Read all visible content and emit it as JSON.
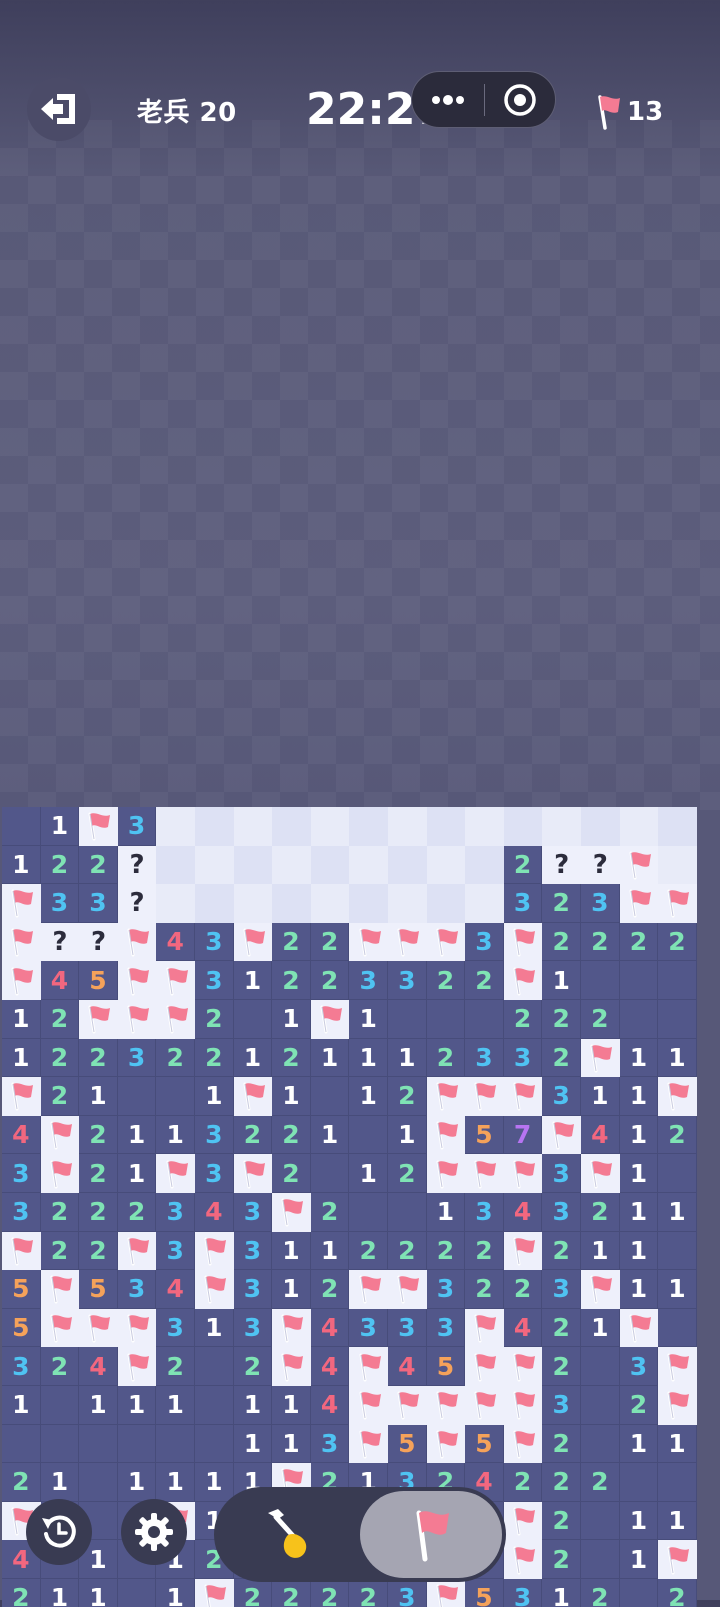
{
  "header": {
    "level_text": "老兵 20",
    "timer": "22:27",
    "flags_remaining": "13"
  },
  "icons": {
    "exit": "exit-icon",
    "more": "more-dots-icon",
    "record": "record-icon",
    "flag": "flag-icon",
    "shovel": "shovel-icon",
    "restart": "restart-icon",
    "settings": "gear-icon"
  },
  "colors": {
    "1": "#ffffff",
    "2": "#7fe3b4",
    "3": "#4fc3f2",
    "4": "#f2677f",
    "5": "#f5a25a",
    "7": "#b774f2",
    "flag": "#f47b93"
  },
  "board": {
    "columns": 18,
    "rows": [
      "R1F3UUUUUUUUUUUUUU",
      "122?UUUUUUUUU2??FU",
      "F33?UUUUUUUUU323FF",
      "F??F43F22FFF3F2222",
      "F45FF31223322F1RRR",
      "12FFF2R1F1RRR222RR",
      "122322121112332F111",
      "F21RR1F1R12FFF311F",
      "4F2113221R1F57F412",
      "3F21F3F2R12FFF3F1R",
      "3222343F2RR1343211R",
      "F22F3F3112222F211R",
      "5F534F312FF3223F111",
      "5FFF313F4333F421F",
      "324F2R2F4F45FF2R3F",
      "1R111R114FFFFF3R2F",
      "RRRRRR113F5F5F2R11",
      "21R1111F21324222RR",
      "F1R1F11RRRRRRF2R11",
      "4R1R12RRRRRRRF2R1F",
      "211R1F22223F5312R2"
    ]
  }
}
